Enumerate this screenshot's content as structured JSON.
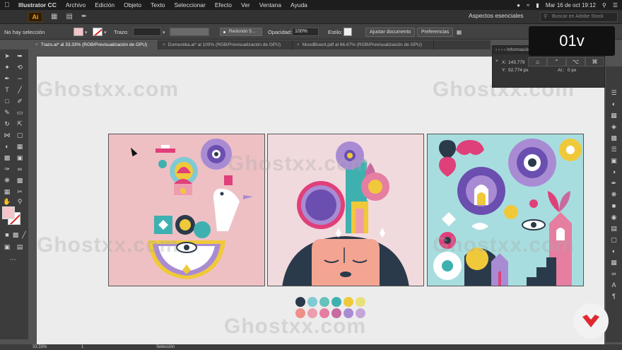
{
  "menubar": {
    "app": "Illustrator CC",
    "items": [
      "Archivo",
      "Edición",
      "Objeto",
      "Texto",
      "Seleccionar",
      "Efecto",
      "Ver",
      "Ventana",
      "Ayuda"
    ],
    "clock": "Mar 16 de oct  19:12"
  },
  "appbar": {
    "logo": "Ai",
    "workspace": "Aspectos esenciales",
    "search_placeholder": "Buscar en Adobe Stock"
  },
  "control_bar": {
    "selection_label": "No hay selección",
    "fill_color": "#f3c4c9",
    "stroke_label": "Trazo:",
    "brush_label": "Redondo 5...",
    "opacity_label": "Opacidad:",
    "opacity_value": "100%",
    "style_label": "Estilo:",
    "doc_setup_button": "Ajustar documento",
    "preferences_button": "Preferencias"
  },
  "tabs": [
    {
      "label": "Trazo.ai* al 33.33% (RGB/Previsualización de GPU)",
      "active": true
    },
    {
      "label": "Domestika.ai* al 100% (RGB/Previsualización de GPU)",
      "active": false
    },
    {
      "label": "MoodBoard.pdf al 66.67% (RGB/Previsualización de GPU)",
      "active": false
    }
  ],
  "info_panel": {
    "tab_label": "Información",
    "x_label": "X:",
    "x_value": "143.779",
    "y_label": "Y:",
    "y_value": "92.774 px",
    "al_label": "Al.:",
    "al_value": "0 px"
  },
  "lesson_badge": "01v",
  "watermark": "Ghostxx.com",
  "palette": {
    "row1": [
      "#2b3a4a",
      "#7fcad4",
      "#67c1bd",
      "#3fb0b0",
      "#f0c93a",
      "#e9e07a"
    ],
    "row2": [
      "#f08f86",
      "#ee9db0",
      "#e57ea1",
      "#c86aa0",
      "#a98bd4",
      "#c6a6d8"
    ]
  },
  "statusbar": {
    "zoom": "33.33%",
    "page": "1",
    "tool": "Selección"
  },
  "colors": {
    "accent_orange": "#ff9a00",
    "canvas_bg": "#ececec",
    "ui_dark": "#323232",
    "brand_red": "#e0292e"
  },
  "icons": [
    "apple-icon",
    "search-icon",
    "wifi-icon",
    "battery-icon",
    "selection-tool-icon",
    "pen-tool-icon",
    "brand-logo-icon"
  ]
}
